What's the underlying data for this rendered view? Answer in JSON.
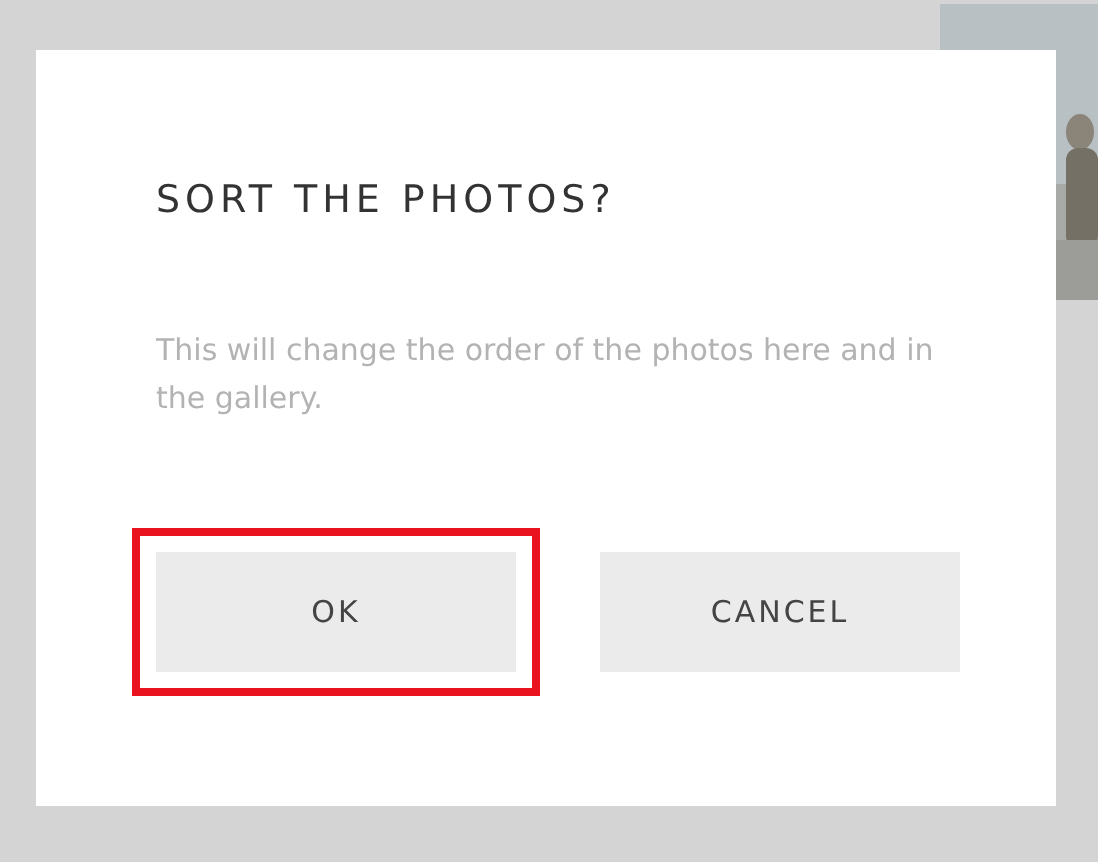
{
  "dialog": {
    "title": "SORT THE PHOTOS?",
    "message": "This will change the order of the photos here and in the gallery.",
    "buttons": [
      {
        "label": "OK",
        "highlighted": true
      },
      {
        "label": "CANCEL",
        "highlighted": false
      }
    ]
  }
}
